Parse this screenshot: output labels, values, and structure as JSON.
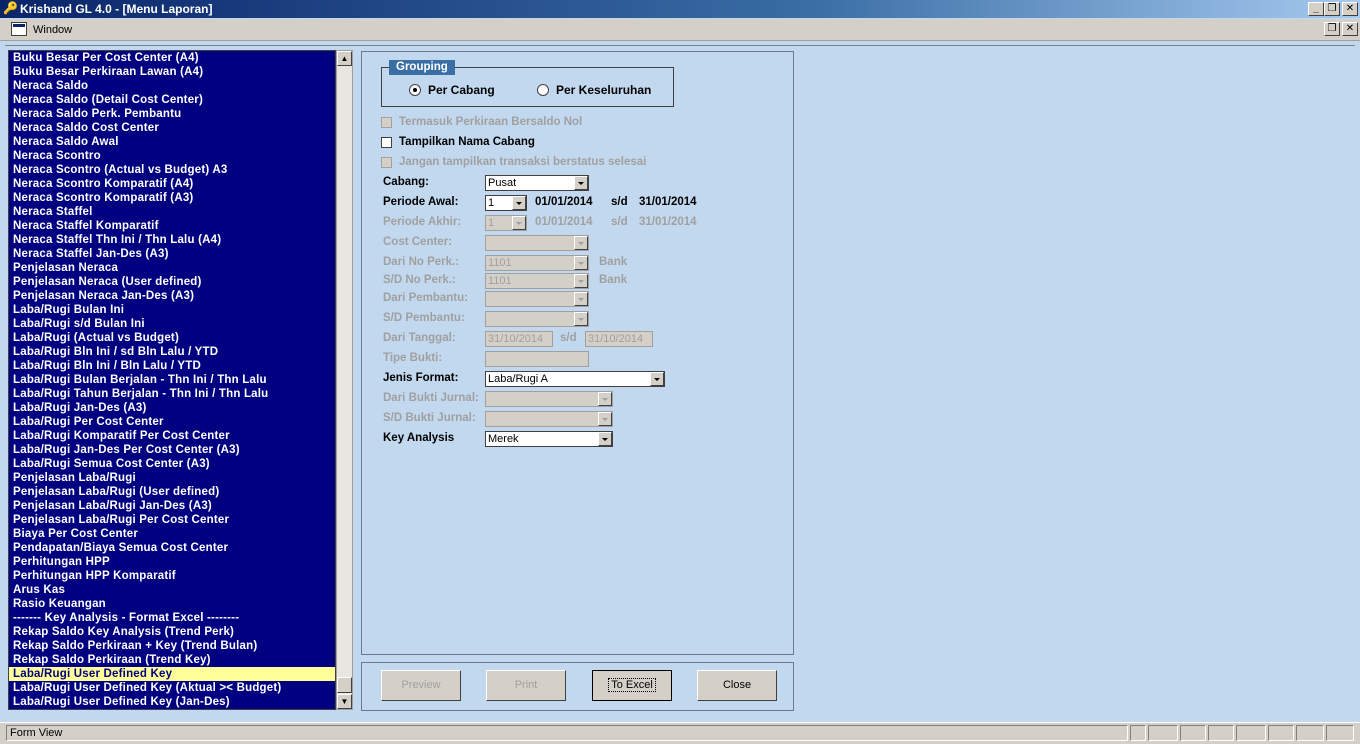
{
  "window": {
    "title": "Krishand GL 4.0 - [Menu Laporan]",
    "menu_window": "Window"
  },
  "report_list": {
    "items": [
      "Buku Besar Per Cost Center (A4)",
      "Buku Besar Perkiraan Lawan (A4)",
      "Neraca Saldo",
      "Neraca Saldo (Detail Cost Center)",
      "Neraca Saldo Perk. Pembantu",
      "Neraca Saldo Cost Center",
      "Neraca Saldo Awal",
      "Neraca Scontro",
      "Neraca Scontro (Actual vs Budget) A3",
      "Neraca Scontro Komparatif (A4)",
      "Neraca Scontro Komparatif (A3)",
      "Neraca Staffel",
      "Neraca Staffel Komparatif",
      "Neraca Staffel Thn Ini / Thn Lalu (A4)",
      "Neraca Staffel Jan-Des (A3)",
      "Penjelasan Neraca",
      "Penjelasan Neraca (User defined)",
      "Penjelasan Neraca Jan-Des (A3)",
      "Laba/Rugi Bulan Ini",
      "Laba/Rugi s/d Bulan Ini",
      "Laba/Rugi (Actual vs Budget)",
      "Laba/Rugi Bln Ini / sd Bln Lalu / YTD",
      "Laba/Rugi Bln Ini / Bln Lalu / YTD",
      "Laba/Rugi Bulan Berjalan - Thn Ini / Thn Lalu",
      "Laba/Rugi Tahun Berjalan - Thn Ini / Thn Lalu",
      "Laba/Rugi Jan-Des (A3)",
      "Laba/Rugi Per Cost Center",
      "Laba/Rugi Komparatif Per Cost Center",
      "Laba/Rugi Jan-Des Per Cost Center (A3)",
      "Laba/Rugi Semua Cost Center (A3)",
      "Penjelasan Laba/Rugi",
      "Penjelasan Laba/Rugi (User defined)",
      "Penjelasan Laba/Rugi Jan-Des (A3)",
      "Penjelasan Laba/Rugi Per Cost Center",
      "Biaya Per Cost Center",
      "Pendapatan/Biaya Semua Cost Center",
      "Perhitungan HPP",
      "Perhitungan HPP Komparatif",
      "Arus Kas",
      "Rasio Keuangan",
      "------- Key Analysis - Format Excel  --------",
      "Rekap Saldo Key Analysis (Trend Perk)",
      "Rekap Saldo Perkiraan + Key (Trend Bulan)",
      "Rekap Saldo Perkiraan (Trend Key)",
      "Laba/Rugi User Defined Key",
      "Laba/Rugi User Defined Key (Aktual >< Budget)",
      "Laba/Rugi User Defined Key (Jan-Des)"
    ],
    "selected_index": 44
  },
  "form": {
    "grouping": {
      "label": "Grouping",
      "per_cabang": "Per Cabang",
      "per_keseluruhan": "Per Keseluruhan"
    },
    "chk_saldo_nol": "Termasuk Perkiraan Bersaldo Nol",
    "chk_nama_cabang": "Tampilkan Nama Cabang",
    "chk_transaksi_selesai": "Jangan tampilkan transaksi berstatus selesai",
    "cabang_label": "Cabang:",
    "cabang_value": "Pusat",
    "periode_awal_label": "Periode Awal:",
    "periode_awal_value": "1",
    "periode_awal_from": "01/01/2014",
    "periode_awal_sd": "s/d",
    "periode_awal_to": "31/01/2014",
    "periode_akhir_label": "Periode Akhir:",
    "periode_akhir_value": "1",
    "periode_akhir_from": "01/01/2014",
    "periode_akhir_sd": "s/d",
    "periode_akhir_to": "31/01/2014",
    "cost_center_label": "Cost Center:",
    "dari_no_perk_label": "Dari No Perk.:",
    "dari_no_perk_value": "1101",
    "dari_no_perk_name": "Bank",
    "sd_no_perk_label": "S/D No Perk.:",
    "sd_no_perk_value": "1101",
    "sd_no_perk_name": "Bank",
    "dari_pembantu_label": "Dari Pembantu:",
    "sd_pembantu_label": "S/D Pembantu:",
    "dari_tanggal_label": "Dari Tanggal:",
    "dari_tanggal_from": "31/10/2014",
    "dari_tanggal_sd": "s/d",
    "dari_tanggal_to": "31/10/2014",
    "tipe_bukti_label": "Tipe Bukti:",
    "jenis_format_label": "Jenis Format:",
    "jenis_format_value": "Laba/Rugi A",
    "dari_bukti_label": "Dari Bukti Jurnal:",
    "sd_bukti_label": "S/D Bukti Jurnal:",
    "key_analysis_label": "Key Analysis",
    "key_analysis_value": "Merek"
  },
  "buttons": {
    "preview": "Preview",
    "print": "Print",
    "to_excel": "To Excel",
    "close": "Close"
  },
  "status": {
    "text": "Form View"
  },
  "colors": {
    "list_bg": "#000080",
    "list_selected_bg": "#ffff99",
    "client_bg": "#c2d8ef",
    "group_label_bg": "#3a6ea5"
  }
}
